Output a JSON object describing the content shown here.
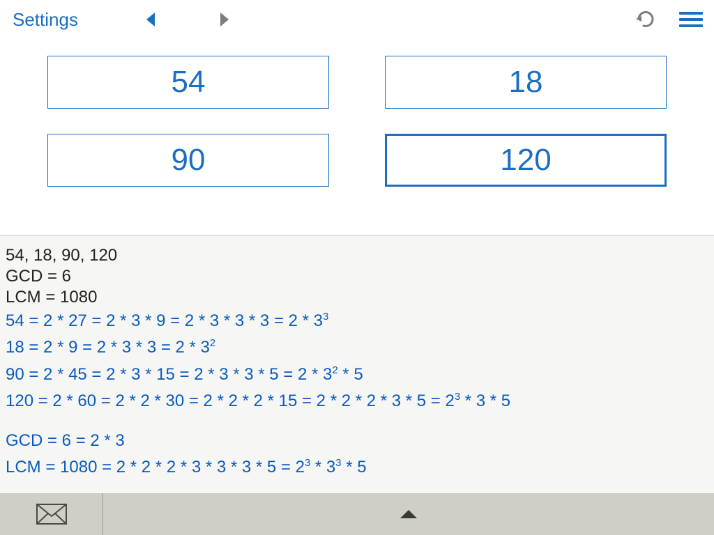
{
  "toolbar": {
    "settings_label": "Settings"
  },
  "inputs": {
    "values": [
      "54",
      "18",
      "90",
      "120"
    ],
    "active_index": 3
  },
  "results": {
    "input_list": "54, 18, 90, 120",
    "gcd_line": "GCD = 6",
    "lcm_line": "LCM = 1080",
    "factorizations": [
      {
        "pre": "54 = 2 * 27 = 2 * 3 * 9 = 2 * 3 * 3 * 3 = 2 * 3",
        "sup": "3",
        "post": ""
      },
      {
        "pre": "18 = 2 * 9 = 2 * 3 * 3 = 2 * 3",
        "sup": "2",
        "post": ""
      },
      {
        "pre": "90 = 2 * 45 = 2 * 3 * 15 = 2 * 3 * 3 * 5 = 2 * 3",
        "sup": "2",
        "post": " * 5"
      },
      {
        "pre": "120 = 2 * 60 = 2 * 2 * 30 = 2 * 2 * 2 * 15 = 2 * 2 * 2 * 3 * 5 = 2",
        "sup": "3",
        "post": " * 3 * 5"
      }
    ],
    "gcd_factor": "GCD = 6 = 2 * 3",
    "lcm_factor": {
      "pre": "LCM = 1080 = 2 * 2 * 2 * 3 * 3 * 3 * 5 = 2",
      "sup1": "3",
      "mid": " * 3",
      "sup2": "3",
      "post": " * 5"
    }
  }
}
